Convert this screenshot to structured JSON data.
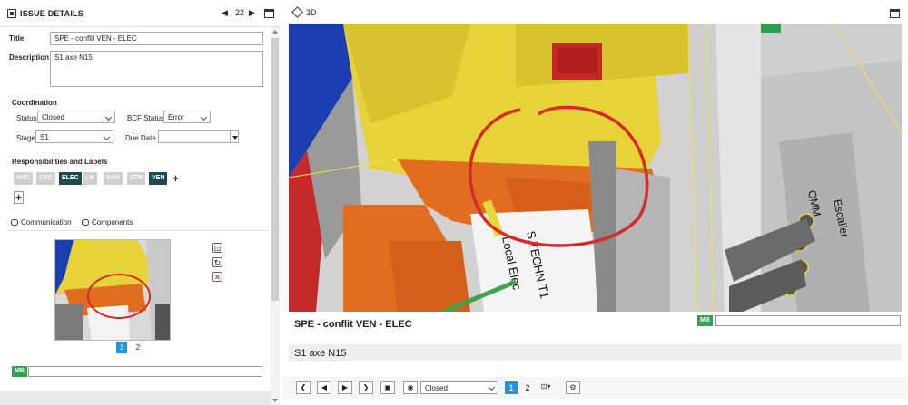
{
  "left_panel": {
    "header": {
      "title": "ISSUE DETAILS",
      "issue_number": "22",
      "prev_arrow": "◀",
      "next_arrow": "▶"
    },
    "title_label": "Title",
    "title_value": "SPE - conflit VEN - ELEC",
    "description_label": "Description",
    "description_value": "S1 axe N15",
    "coordination": {
      "section_label": "Coordination",
      "status_label": "Status",
      "status_value": "Closed",
      "bcf_status_label": "BCF Status",
      "bcf_status_value": "Error",
      "stage_label": "Stage",
      "stage_value": "S1",
      "due_date_label": "Due Date",
      "due_date_value": ""
    },
    "responsibilities": {
      "section_label": "Responsibilities and Labels",
      "tags": [
        {
          "label": "ARC",
          "active": false
        },
        {
          "label": "CVC",
          "active": false
        },
        {
          "label": "ELEC",
          "active": true
        },
        {
          "label": "LM",
          "active": false
        },
        {
          "label": "SAN",
          "active": false
        },
        {
          "label": "STR",
          "active": false
        },
        {
          "label": "VEN",
          "active": true
        }
      ],
      "add_symbol": "+"
    },
    "tabs": [
      {
        "label": "Communication",
        "active": true
      },
      {
        "label": "Components",
        "active": false
      }
    ],
    "snapshot_pages": [
      "1",
      "2"
    ],
    "comment_author_badge": "MB",
    "comment_value": ""
  },
  "right_panel": {
    "view_label": "3D",
    "issue_title": "SPE - conflit VEN - ELEC",
    "issue_description": "S1 axe N15",
    "scene_labels": {
      "wall_text_1": "Local Elec",
      "wall_text_2": "S.TECHN.T1",
      "stair_text_1": "Escalier",
      "stair_text_2": "OMM"
    },
    "comment_author_badge": "MB",
    "toolbar": {
      "status_value": "Closed",
      "pages": [
        "1",
        "2"
      ]
    }
  },
  "colors": {
    "tag_active": "#1d4a52",
    "tag_inactive": "#cfcfcf",
    "page_active": "#2891d4",
    "mb_badge": "#37a050",
    "markup_circle": "#d62a2a"
  }
}
